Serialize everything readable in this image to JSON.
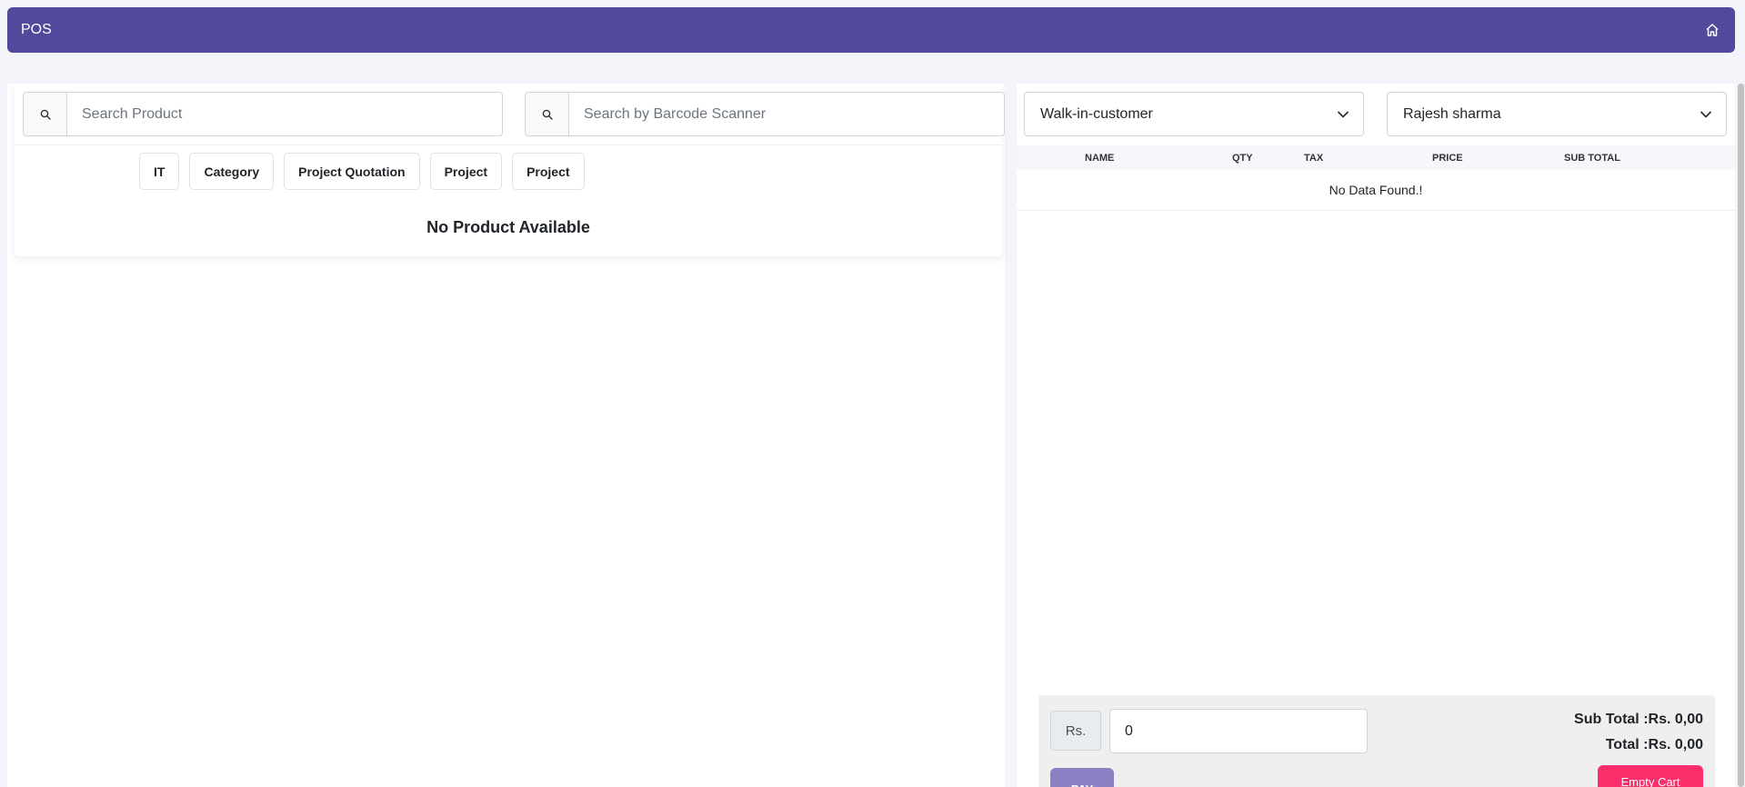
{
  "header": {
    "title": "POS",
    "home_icon": "home-icon"
  },
  "search": {
    "product_placeholder": "Search Product",
    "barcode_placeholder": "Search by Barcode Scanner",
    "icon": "search-icon"
  },
  "categories": [
    "IT",
    "Category",
    "Project Quotation",
    "Project",
    "Project"
  ],
  "products": {
    "empty_message": "No Product Available"
  },
  "customer": {
    "selected": "Walk-in-customer"
  },
  "user": {
    "selected": "Rajesh sharma"
  },
  "cart": {
    "columns": [
      "NAME",
      "QTY",
      "TAX",
      "PRICE",
      "SUB TOTAL"
    ],
    "empty_message": "No Data Found.!"
  },
  "footer": {
    "currency": "Rs.",
    "amount": "0",
    "sub_total": "Sub Total :Rs. 0,00",
    "total": "Total :Rs. 0,00",
    "pay_label": "PAY",
    "empty_cart_label": "Empty Cart"
  },
  "colors": {
    "header_bg": "#52489c",
    "pay_button": "#8a82c4",
    "empty_cart_button": "#fb2d6a"
  }
}
